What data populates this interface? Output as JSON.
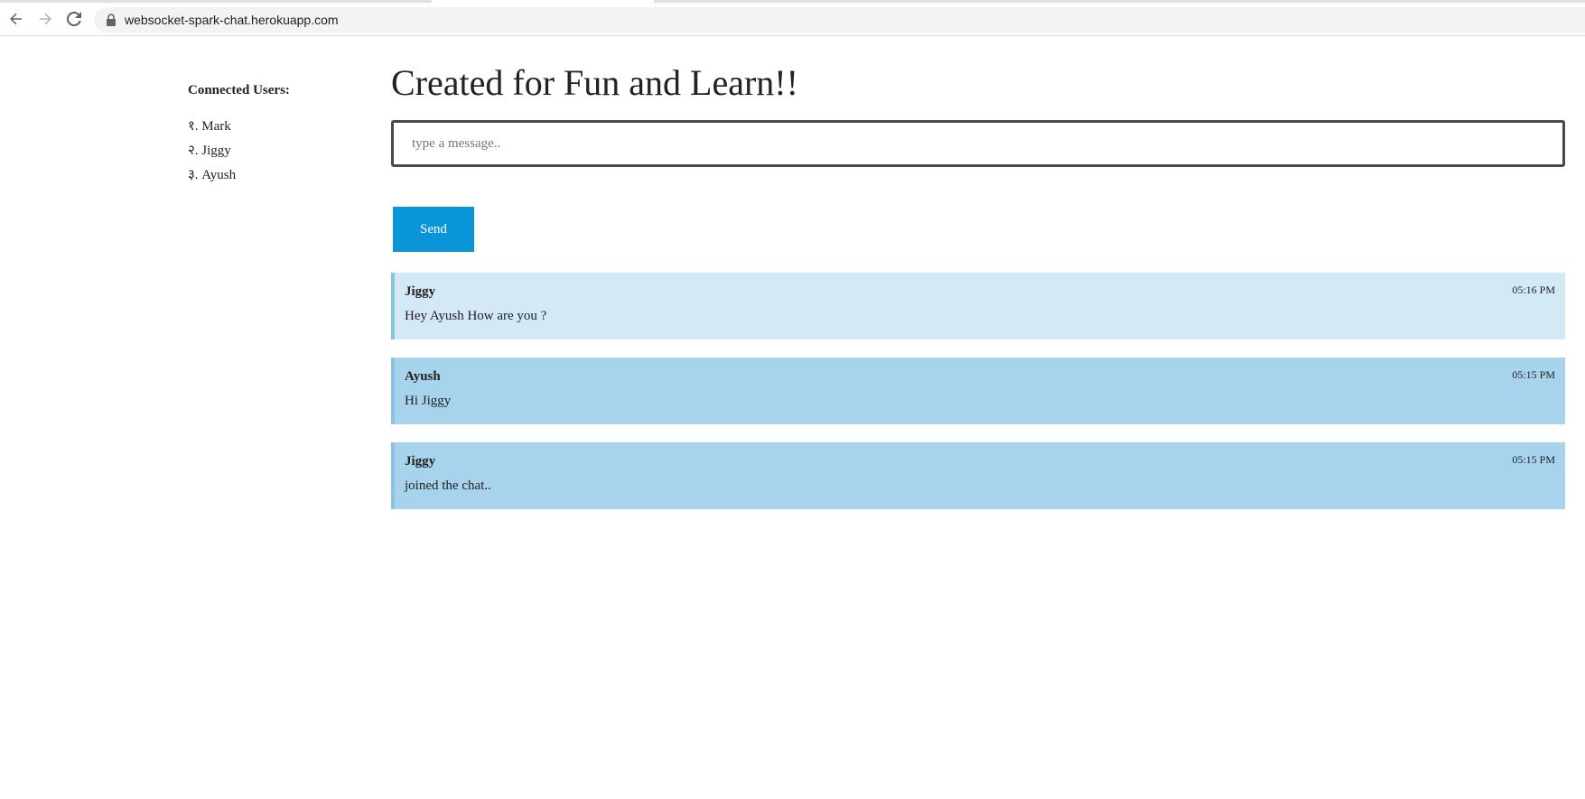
{
  "browser": {
    "url": "websocket-spark-chat.herokuapp.com"
  },
  "sidebar": {
    "title": "Connected Users:",
    "users": [
      {
        "label": "१. Mark"
      },
      {
        "label": "२. Jiggy"
      },
      {
        "label": "३. Ayush"
      }
    ]
  },
  "main": {
    "title": "Created for Fun and Learn!!",
    "input_placeholder": "type a message..",
    "send_label": "Send"
  },
  "messages": [
    {
      "author": "Jiggy",
      "text": "Hey Ayush How are you ?",
      "time": "05:16 PM",
      "shade": "light"
    },
    {
      "author": "Ayush",
      "text": "Hi Jiggy",
      "time": "05:15 PM",
      "shade": "dark"
    },
    {
      "author": "Jiggy",
      "text": "joined the chat..",
      "time": "05:15 PM",
      "shade": "dark"
    }
  ],
  "colors": {
    "accent": "#0a95d8",
    "message_light": "#d3e9f6",
    "message_dark": "#a7d4ec",
    "message_border": "#89c4e4"
  }
}
